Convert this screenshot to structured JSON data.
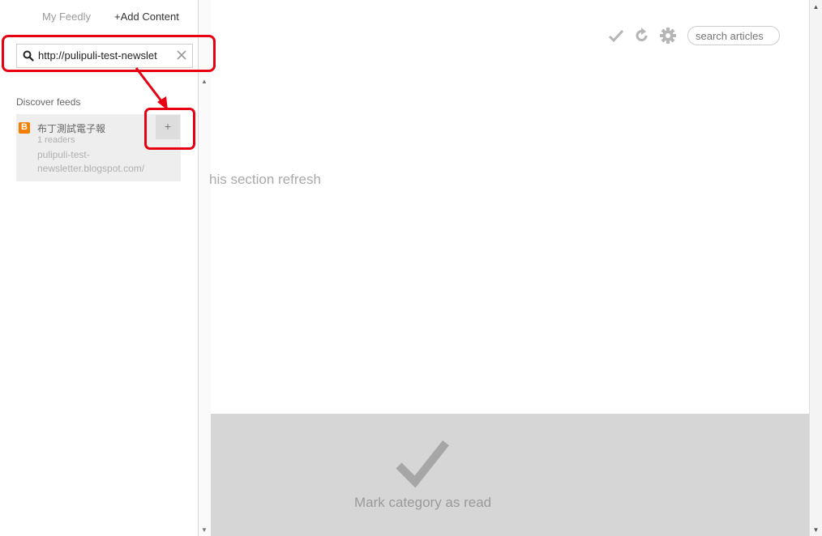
{
  "sidebar": {
    "nav": {
      "my_feedly": "My Feedly",
      "add_content": "+Add Content"
    },
    "search": {
      "value": "http://pulipuli-test-newslet"
    },
    "discover": {
      "title": "Discover feeds",
      "feeds": [
        {
          "name": "布丁測試電子報",
          "readers": "1 readers",
          "url": "pulipuli-test-newsletter.blogspot.com/",
          "url_line1": "pulipuli-test-",
          "url_line2": "newsletter.blogspot.com/",
          "add_label": "+"
        }
      ]
    }
  },
  "main": {
    "toolbar": {
      "search_placeholder": "search articles",
      "icons": [
        "check-icon",
        "refresh-icon",
        "gear-icon"
      ]
    },
    "section_text": "his section refresh",
    "mark_panel": {
      "label": "Mark category as read"
    }
  },
  "colors": {
    "annotation": "#e60012",
    "blogger": "#f57d00",
    "panel": "#d6d6d6"
  }
}
